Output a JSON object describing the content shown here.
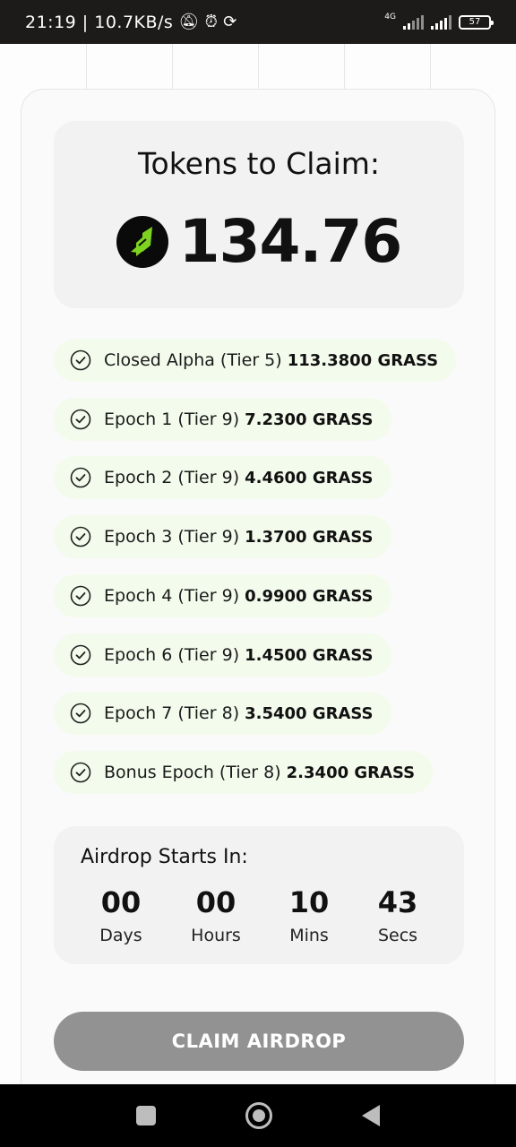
{
  "status_bar": {
    "time_speed": "21:19 | 10.7KB/s",
    "network": "4G",
    "battery": "57",
    "icons": [
      "muted-bell-icon",
      "alarm-icon",
      "sync-icon"
    ]
  },
  "tokens": {
    "title": "Tokens to Claim:",
    "amount": "134.76",
    "logo_icon": "grass-logo-icon"
  },
  "claims": [
    {
      "label": "Closed Alpha (Tier 5)",
      "amount": "113.3800 GRASS"
    },
    {
      "label": "Epoch 1 (Tier 9)",
      "amount": "7.2300 GRASS"
    },
    {
      "label": "Epoch 2 (Tier 9)",
      "amount": "4.4600 GRASS"
    },
    {
      "label": "Epoch 3 (Tier 9)",
      "amount": "1.3700 GRASS"
    },
    {
      "label": "Epoch 4 (Tier 9)",
      "amount": "0.9900 GRASS"
    },
    {
      "label": "Epoch 6 (Tier 9)",
      "amount": "1.4500 GRASS"
    },
    {
      "label": "Epoch 7 (Tier 8)",
      "amount": "3.5400 GRASS"
    },
    {
      "label": "Bonus Epoch (Tier 8)",
      "amount": "2.3400 GRASS"
    }
  ],
  "countdown": {
    "title": "Airdrop Starts In:",
    "units": [
      {
        "value": "00",
        "label": "Days"
      },
      {
        "value": "00",
        "label": "Hours"
      },
      {
        "value": "10",
        "label": "Mins"
      },
      {
        "value": "43",
        "label": "Secs"
      }
    ]
  },
  "claim_button": {
    "label": "CLAIM AIRDROP"
  },
  "colors": {
    "claim_bg": "#f3fbec",
    "button_disabled": "#929292",
    "logo_green": "#7ed321"
  }
}
